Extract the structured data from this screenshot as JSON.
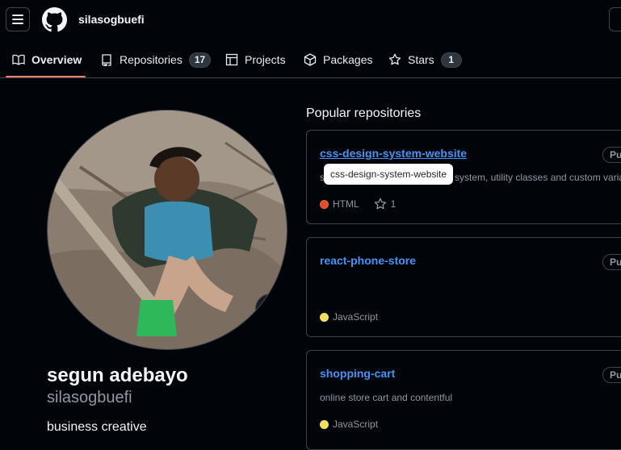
{
  "header": {
    "menu_icon": "hamburger-icon",
    "logo_icon": "github-mark-icon",
    "username": "silasogbuefi"
  },
  "tabs": [
    {
      "label": "Overview",
      "icon": "book-icon",
      "active": true
    },
    {
      "label": "Repositories",
      "icon": "repo-icon",
      "count": "17"
    },
    {
      "label": "Projects",
      "icon": "table-icon"
    },
    {
      "label": "Packages",
      "icon": "package-icon"
    },
    {
      "label": "Stars",
      "icon": "star-icon",
      "count": "1"
    }
  ],
  "profile": {
    "full_name": "segun adebayo",
    "login": "silasogbuefi",
    "bio": "business creative",
    "status_icon": "smiley-icon"
  },
  "popular": {
    "title": "Popular repositories",
    "repos": [
      {
        "name": "css-design-system-website",
        "visibility": "Pul",
        "description": "system, utility classes and custom variab",
        "desc_prefix": "s",
        "language": "HTML",
        "language_color": "#e34c26",
        "stars": "1"
      },
      {
        "name": "react-phone-store",
        "visibility": "Pul",
        "description": "",
        "language": "JavaScript",
        "language_color": "#f1e05a"
      },
      {
        "name": "shopping-cart",
        "visibility": "Pul",
        "description": "online store cart and contentful",
        "language": "JavaScript",
        "language_color": "#f1e05a"
      }
    ]
  },
  "tooltip": {
    "text": "css-design-system-website"
  }
}
